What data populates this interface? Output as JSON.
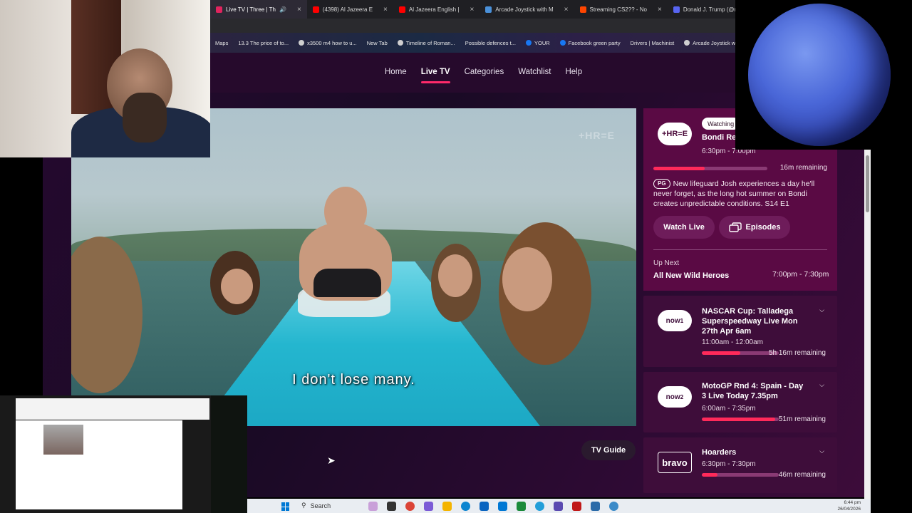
{
  "browser": {
    "tabs": [
      {
        "label": "Live TV | Three | Th",
        "color": "#e0245e",
        "active": true
      },
      {
        "label": "(4398) Al Jazeera E",
        "color": "#ff0000"
      },
      {
        "label": "Al Jazeera English |",
        "color": "#ff0000"
      },
      {
        "label": "Arcade Joystick with M",
        "color": "#4a90d9"
      },
      {
        "label": "Streaming CS2?? - No",
        "color": "#ff4500"
      },
      {
        "label": "Donald J. Trump (@rea",
        "color": "#5865f2"
      }
    ],
    "new_tab": "+",
    "bookmarks": [
      "Maps",
      "13.3 The price of to...",
      "x3500 m4 how to u...",
      "New Tab",
      "Timeline of Roman...",
      "Possible defences t...",
      "YOUR",
      "Facebook green party",
      "Drivers | Machinist",
      "Arcade Joystick w..."
    ]
  },
  "site": {
    "nav": [
      "Home",
      "Live TV",
      "Categories",
      "Watchlist",
      "Help"
    ],
    "active_nav": "Live TV",
    "video": {
      "watermark": "+HR=E",
      "subtitle": "I don't lose many."
    },
    "tv_guide_label": "TV Guide",
    "now_playing": {
      "channel_logo": "+HR=E",
      "badge": "Watching",
      "title": "Bondi Res",
      "time": "6:30pm - 7:00pm",
      "remaining": "16m remaining",
      "progress": 0.45,
      "rating": "PG",
      "description": "New lifeguard Josh experiences a day he'll never forget, as the long hot summer on Bondi creates unpredictable conditions. S14 E1",
      "watch_live": "Watch Live",
      "episodes": "Episodes"
    },
    "up_next": {
      "label": "Up Next",
      "title": "All New Wild Heroes",
      "time": "7:00pm - 7:30pm"
    },
    "channels": [
      {
        "logo": "now",
        "logo_num": "1",
        "title": "NASCAR Cup: Talladega Superspeedway Live Mon 27th Apr 6am",
        "time": "11:00am - 12:00am",
        "remaining": "5h 16m remaining",
        "progress": 0.5
      },
      {
        "logo": "now",
        "logo_num": "2",
        "title": "MotoGP Rnd 4: Spain - Day 3 Live Today 7.35pm",
        "time": "6:00am - 7:35pm",
        "remaining": "51m remaining",
        "progress": 0.95
      },
      {
        "logo": "bravo",
        "logo_num": "",
        "title": "Hoarders",
        "time": "6:30pm - 7:30pm",
        "remaining": "46m remaining",
        "progress": 0.2
      }
    ]
  },
  "taskbar": {
    "search": "Search",
    "time": "6:44 pm",
    "date": "26/04/2026"
  },
  "colors": {
    "accent": "#ff2a5a",
    "brand": "#5a0a44"
  }
}
